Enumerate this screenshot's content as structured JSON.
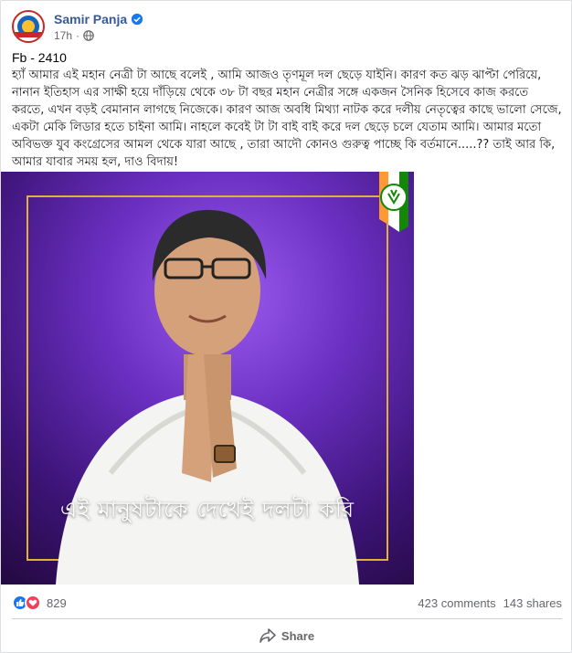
{
  "post": {
    "author": "Samir Panja",
    "time": "17h",
    "dot": "·",
    "id_text": "Fb - 2410",
    "body": "হ্যাঁ আমার এই মহান নেত্রী টা আছে বলেই , আমি আজও তৃণমূল দল ছেড়ে যাইনি। কারণ কত ঝড় ঝাপ্টা পেরিয়ে, নানান ইতিহাস এর সাক্ষী হয়ে দাঁড়িয়ে থেকে ৩৮ টা বছর মহান নেত্রীর সঙ্গে একজন সৈনিক হিসেবে কাজ করতে করতে, এখন বড়ই বেমানান লাগছে নিজেকে। কারণ আজ অবধি মিথ্যা নাটক করে দলীয় নেতৃত্বের কাছে ভালো সেজে, একটা মেকি লিডার হতে চাইনা আমি। নাহলে কবেই টা টা বাই বাই করে দল ছেড়ে চলে যেতাম আমি। আমার মতো অবিভক্ত যুব কংগ্রেসের আমল থেকে যারা আছে , তারা আদৌ কোনও গুরুত্ব পাচ্ছে কি বর্তমানে.....?? তাই আর কি, আমার যাবার সময় হল, দাও বিদায়!",
    "image_caption": "এই মানুষটাকে দেখেই দলটা করি"
  },
  "stats": {
    "reactions": "829",
    "comments": "423 comments",
    "shares": "143 shares"
  },
  "actions": {
    "share": "Share"
  },
  "colors": {
    "name": "#385898",
    "like": "#1877f2",
    "love": "#f33e58",
    "frame": "#e2b13c"
  },
  "icons": [
    "verified-badge-icon",
    "globe-icon",
    "like-reaction-icon",
    "love-reaction-icon",
    "share-arrow-icon"
  ]
}
